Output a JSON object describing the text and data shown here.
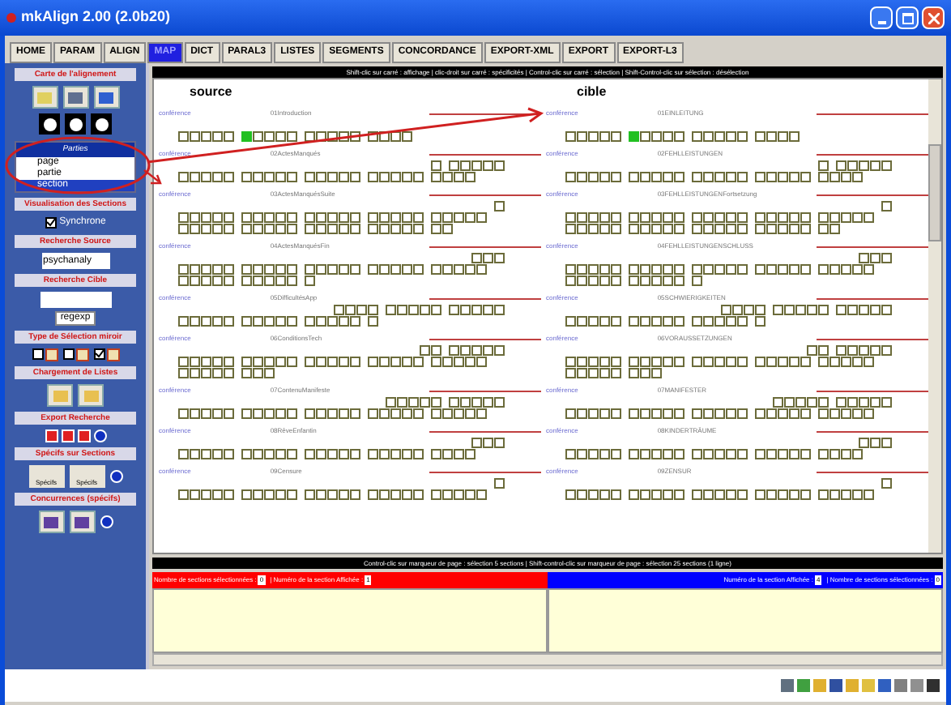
{
  "window": {
    "title": "mkAlign 2.00 (2.0b20)"
  },
  "tabs": [
    {
      "label": "HOME",
      "selected": false
    },
    {
      "label": "PARAM",
      "selected": false
    },
    {
      "label": "ALIGN",
      "selected": false
    },
    {
      "label": "MAP",
      "selected": true
    },
    {
      "label": "DICT",
      "selected": false
    },
    {
      "label": "PARAL3",
      "selected": false
    },
    {
      "label": "LISTES",
      "selected": false
    },
    {
      "label": "SEGMENTS",
      "selected": false
    },
    {
      "label": "CONCORDANCE",
      "selected": false
    },
    {
      "label": "EXPORT-XML",
      "selected": false
    },
    {
      "label": "EXPORT",
      "selected": false
    },
    {
      "label": "EXPORT-L3",
      "selected": false
    }
  ],
  "sidebar": {
    "map_heading": "Carte de l'alignement",
    "parts": {
      "heading": "Parties",
      "items": [
        {
          "label": "page",
          "selected": false
        },
        {
          "label": "partie",
          "selected": false
        },
        {
          "label": "section",
          "selected": true
        }
      ]
    },
    "view_heading": "Visualisation des Sections",
    "sync": {
      "label": "Synchrone",
      "checked": true
    },
    "source_search": {
      "heading": "Recherche Source",
      "value": "psychanaly"
    },
    "target_search": {
      "heading": "Recherche Cible",
      "button": "regexp"
    },
    "mirror": {
      "heading": "Type de Sélection miroir",
      "options": [
        {
          "checked": false
        },
        {
          "checked": false
        },
        {
          "checked": true
        }
      ]
    },
    "lists_heading": "Chargement de Listes",
    "export_heading": "Export Recherche",
    "specifs": {
      "heading": "Spécifs sur Sections",
      "buttons": [
        "Spécifs",
        "Spécifs"
      ]
    },
    "concurrences_heading": "Concurrences (spécifs)"
  },
  "hint_top": "Shift-clic sur carré : affichage | clic-droit sur carré : spécificités | Control-clic sur carré : sélection | Shift-Control-clic sur sélection : désélection",
  "columns": [
    {
      "heading": "source",
      "sections": [
        {
          "label": "conférence",
          "title": "01Introduction",
          "highlighted": true
        },
        {
          "label": "conférence",
          "title": "02ActesManqués",
          "highlighted": false
        },
        {
          "label": "conférence",
          "title": "03ActesManquésSuite",
          "highlighted": false
        },
        {
          "label": "conférence",
          "title": "04ActesManquésFin",
          "highlighted": false
        },
        {
          "label": "conférence",
          "title": "05DifficultésApp",
          "highlighted": false
        },
        {
          "label": "conférence",
          "title": "06ConditionsTech",
          "highlighted": false
        },
        {
          "label": "conférence",
          "title": "07ContenuManifeste",
          "highlighted": false
        },
        {
          "label": "conférence",
          "title": "08RêveEnfantin",
          "highlighted": false
        },
        {
          "label": "conférence",
          "title": "09Censure",
          "highlighted": false
        }
      ]
    },
    {
      "heading": "cible",
      "sections": [
        {
          "label": "conférence",
          "title": "01EINLEITUNG",
          "highlighted": true
        },
        {
          "label": "conférence",
          "title": "02FEHLLEISTUNGEN",
          "highlighted": false
        },
        {
          "label": "conférence",
          "title": "03FEHLLEISTUNGENFortsetzung",
          "highlighted": false
        },
        {
          "label": "conférence",
          "title": "04FEHLLEISTUNGENSCHLUSS",
          "highlighted": false
        },
        {
          "label": "conférence",
          "title": "05SCHWIERIGKEITEN",
          "highlighted": false
        },
        {
          "label": "conférence",
          "title": "06VORAUSSETZUNGEN",
          "highlighted": false
        },
        {
          "label": "conférence",
          "title": "07MANIFESTER",
          "highlighted": false
        },
        {
          "label": "conférence",
          "title": "08KINDERTRÄUME",
          "highlighted": false
        },
        {
          "label": "conférence",
          "title": "09ZENSUR",
          "highlighted": false
        }
      ]
    }
  ],
  "hint_bottom": "Control-clic sur marqueur de page : sélection 5 sections | Shift-control-clic sur marqueur de page : sélection 25 sections (1 ligne)",
  "source_status": [
    {
      "label": "Nombre de sections sélectionnées :",
      "value": "0"
    },
    {
      "label": "| Numéro de la section Affichée :",
      "value": "1"
    }
  ],
  "target_status": [
    {
      "label": "Numéro de la section Affichée :",
      "value": "4"
    },
    {
      "label": "| Nombre de sections sélectionnées :",
      "value": "0"
    }
  ]
}
